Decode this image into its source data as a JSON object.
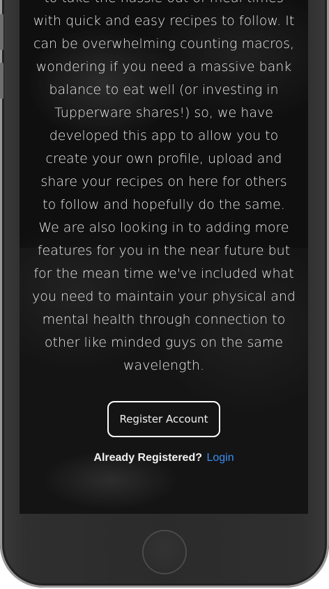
{
  "intro": {
    "text": "to take the hassle out of meal times with quick and easy recipes to follow. It can be overwhelming counting macros, wondering if you need a massive bank balance to eat well (or investing in Tupperware shares!) so, we have developed this app to allow you to create your own profile, upload and share your recipes on here for others to follow and hopefully do the same. We are also looking in to adding more features for you in the near future but for the mean time we've included what you need to maintain your physical and mental health through connection to other like minded guys on the same wavelength."
  },
  "register": {
    "label": "Register Account"
  },
  "auth": {
    "prompt": "Already Registered?",
    "login_label": "Login",
    "link_color": "#3b8ef0"
  }
}
